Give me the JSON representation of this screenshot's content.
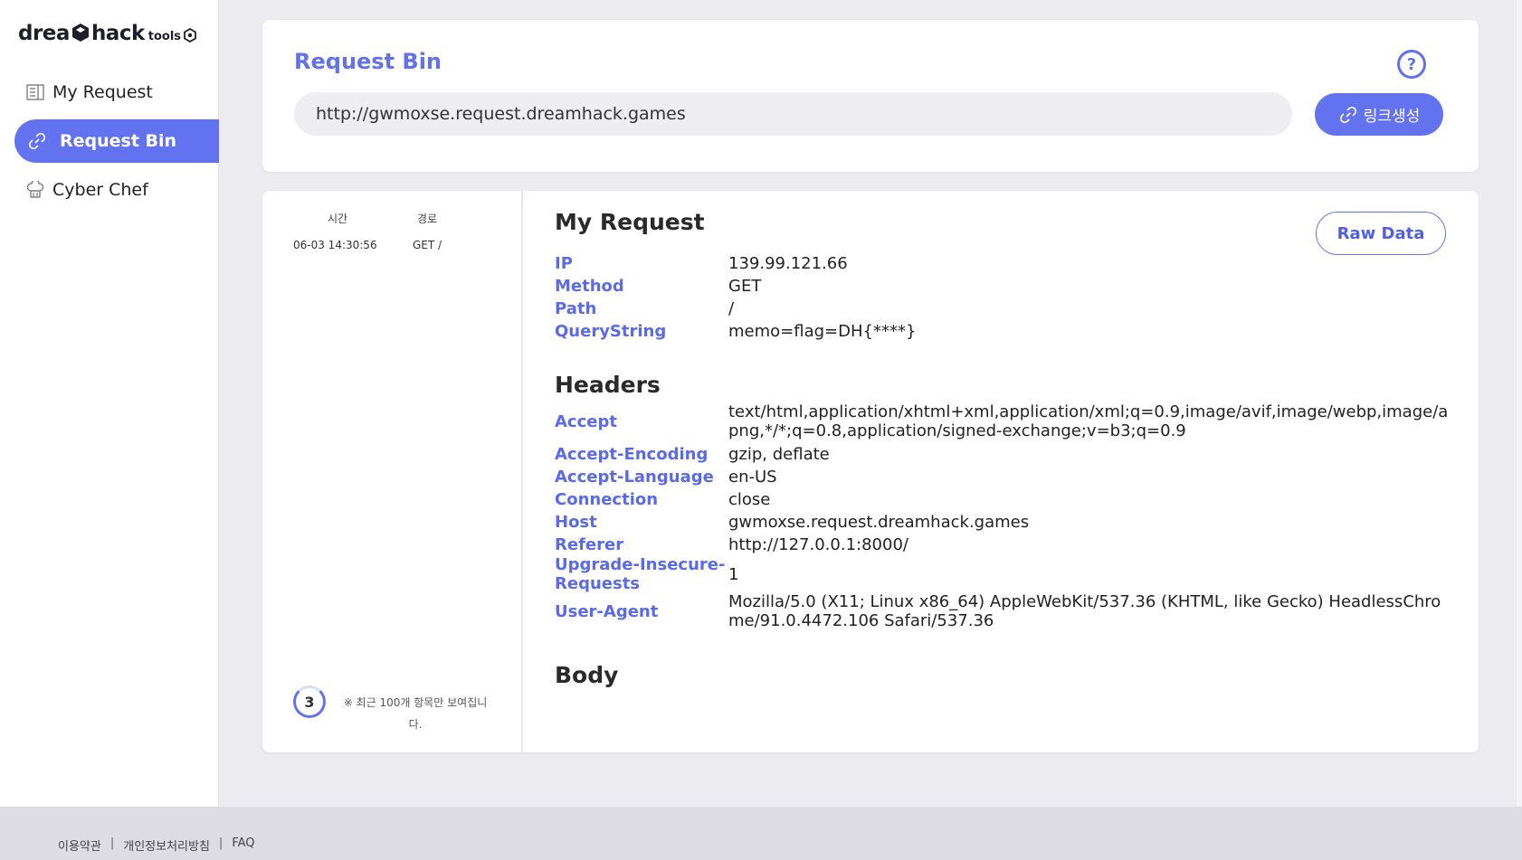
{
  "logo": {
    "brand": "drea",
    "brand2": "hack",
    "suffix": "tools"
  },
  "sidebar": {
    "items": [
      {
        "label": "My Request",
        "icon": "document-icon",
        "active": false
      },
      {
        "label": "Request Bin",
        "icon": "link-icon",
        "active": true
      },
      {
        "label": "Cyber Chef",
        "icon": "chef-hat-icon",
        "active": false
      }
    ]
  },
  "request_bin": {
    "title": "Request Bin",
    "url": "http://gwmoxse.request.dreamhack.games",
    "link_button": "링크생성"
  },
  "history": {
    "col_time": "시간",
    "col_path": "경로",
    "rows": [
      {
        "time": "06-03 14:30:56",
        "path": "GET /"
      }
    ],
    "counter": "3",
    "notice": "※ 최근 100개 항목만 보여집니다."
  },
  "detail": {
    "my_request_title": "My Request",
    "raw_button": "Raw Data",
    "request": [
      {
        "key": "IP",
        "value": "139.99.121.66"
      },
      {
        "key": "Method",
        "value": "GET"
      },
      {
        "key": "Path",
        "value": "/"
      },
      {
        "key": "QueryString",
        "value": "memo=flag=DH{****}"
      }
    ],
    "headers_title": "Headers",
    "headers": [
      {
        "key": "Accept",
        "value": "text/html,application/xhtml+xml,application/xml;q=0.9,image/avif,image/webp,image/apng,*/*;q=0.8,application/signed-exchange;v=b3;q=0.9"
      },
      {
        "key": "Accept-Encoding",
        "value": "gzip, deflate"
      },
      {
        "key": "Accept-Language",
        "value": "en-US"
      },
      {
        "key": "Connection",
        "value": "close"
      },
      {
        "key": "Host",
        "value": "gwmoxse.request.dreamhack.games"
      },
      {
        "key": "Referer",
        "value": "http://127.0.0.1:8000/"
      },
      {
        "key": "Upgrade-Insecure-Requests",
        "value": "1"
      },
      {
        "key": "User-Agent",
        "value": "Mozilla/5.0 (X11; Linux x86_64) AppleWebKit/537.36 (KHTML, like Gecko) HeadlessChrome/91.0.4472.106 Safari/537.36"
      }
    ],
    "body_title": "Body"
  },
  "footer": {
    "terms": "이용약관",
    "privacy": "개인정보처리방침",
    "faq": "FAQ"
  },
  "colors": {
    "accent": "#6373f0",
    "label": "#5a6ae8",
    "background": "#ececf0"
  }
}
